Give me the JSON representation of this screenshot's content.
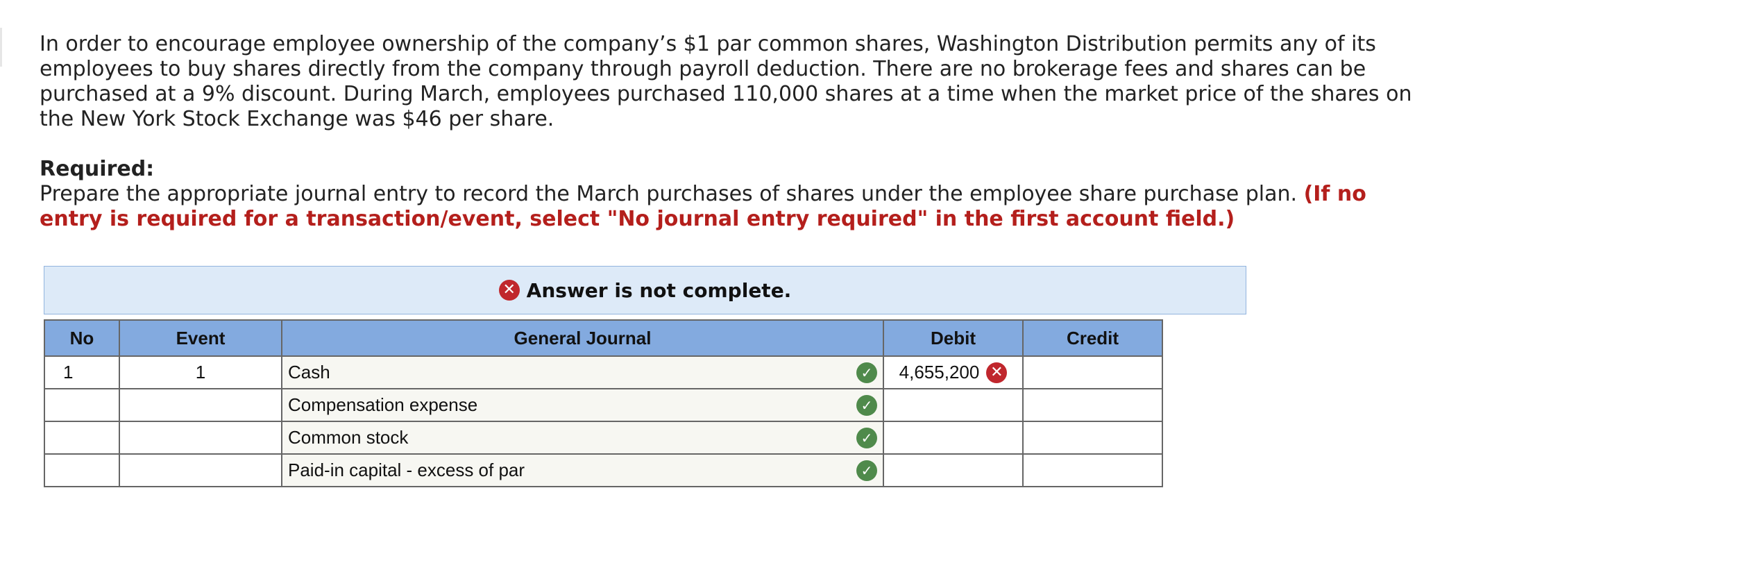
{
  "problem": {
    "paragraph": "In order to encourage employee ownership of the company’s $1 par common shares, Washington Distribution permits any of its employees to buy shares directly from the company through payroll deduction. There are no brokerage fees and shares can be purchased at a 9% discount. During March, employees purchased 110,000 shares at a time when the market price of the shares on the New York Stock Exchange was $46 per share.",
    "required_label": "Required:",
    "instruction": "Prepare the appropriate journal entry to record the March purchases of shares under the employee share purchase plan.",
    "note": "(If no entry is required for a transaction/event, select \"No journal entry required\" in the first account field.)"
  },
  "banner": {
    "status_icon": "x-circle-icon",
    "message": "Answer is not complete."
  },
  "journal": {
    "headers": {
      "no": "No",
      "event": "Event",
      "general_journal": "General Journal",
      "debit": "Debit",
      "credit": "Credit"
    },
    "rows": [
      {
        "no": "1",
        "event": "1",
        "account": "Cash",
        "account_status": "correct",
        "debit": "4,655,200",
        "debit_status": "incorrect",
        "credit": ""
      },
      {
        "no": "",
        "event": "",
        "account": "Compensation expense",
        "account_status": "correct",
        "debit": "",
        "credit": ""
      },
      {
        "no": "",
        "event": "",
        "account": "Common stock",
        "account_status": "correct",
        "debit": "",
        "credit": ""
      },
      {
        "no": "",
        "event": "",
        "account": "Paid-in capital - excess of par",
        "account_status": "correct",
        "debit": "",
        "credit": ""
      }
    ]
  },
  "colors": {
    "note_red": "#b41f1c",
    "banner_bg": "#ddeaf8",
    "header_blue": "#83aadf",
    "check_green": "#4f8a4b",
    "error_red": "#c0272d"
  }
}
